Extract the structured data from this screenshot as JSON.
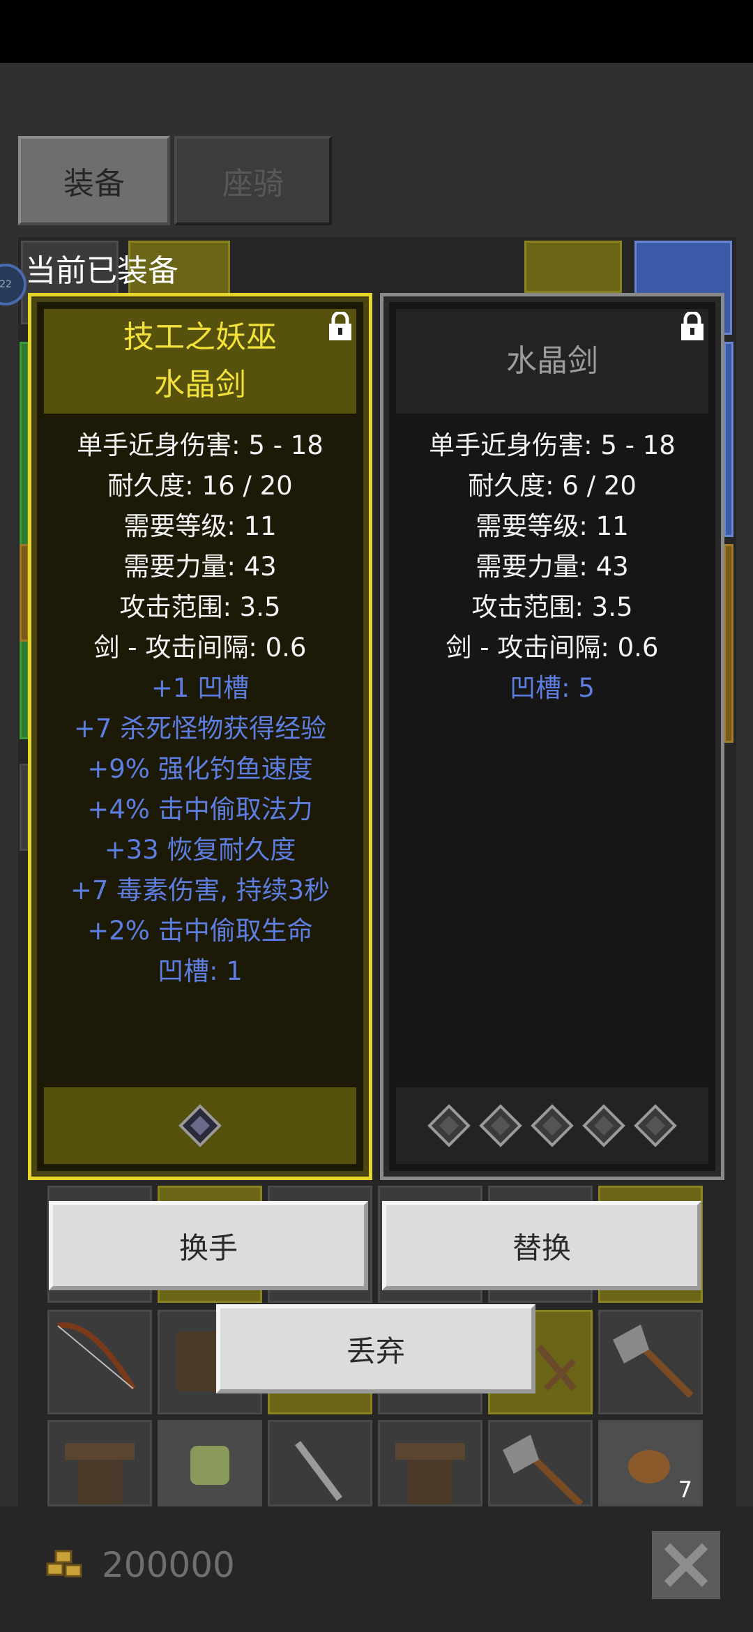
{
  "tabs": [
    {
      "label": "装备"
    },
    {
      "label": "座骑"
    }
  ],
  "level_badge": "22",
  "current_equipped_label": "当前已装备",
  "left_card": {
    "title_line1": "技工之妖巫",
    "title_line2": "水晶剑",
    "border_color": "#e6d52a",
    "stats": [
      {
        "text": "单手近身伤害: 5 - 18",
        "color": "white"
      },
      {
        "text": "耐久度: 16 / 20",
        "color": "white"
      },
      {
        "text": "需要等级: 11",
        "color": "white"
      },
      {
        "text": "需要力量: 43",
        "color": "white"
      },
      {
        "text": "攻击范围: 3.5",
        "color": "white"
      },
      {
        "text": "剑 - 攻击间隔: 0.6",
        "color": "white"
      },
      {
        "text": "+1 凹槽",
        "color": "blue"
      },
      {
        "text": "+7 杀死怪物获得经验",
        "color": "blue"
      },
      {
        "text": "+9% 强化钓鱼速度",
        "color": "blue"
      },
      {
        "text": "+4% 击中偷取法力",
        "color": "blue"
      },
      {
        "text": "+33 恢复耐久度",
        "color": "blue"
      },
      {
        "text": "+7 毒素伤害, 持续3秒",
        "color": "blue"
      },
      {
        "text": "+2% 击中偷取生命",
        "color": "blue"
      },
      {
        "text": "凹槽: 1",
        "color": "blue"
      }
    ],
    "socket_count": 1,
    "socket_filled": true
  },
  "right_card": {
    "title": "水晶剑",
    "border_color": "#8a8a8a",
    "stats": [
      {
        "text": "单手近身伤害: 5 - 18",
        "color": "white"
      },
      {
        "text": "耐久度: 6 / 20",
        "color": "white"
      },
      {
        "text": "需要等级: 11",
        "color": "white"
      },
      {
        "text": "需要力量: 43",
        "color": "white"
      },
      {
        "text": "攻击范围: 3.5",
        "color": "white"
      },
      {
        "text": "剑 - 攻击间隔: 0.6",
        "color": "white"
      },
      {
        "text": "凹槽: 5",
        "color": "blue"
      }
    ],
    "socket_count": 5,
    "socket_filled": false
  },
  "buttons": {
    "swap_hand": "换手",
    "replace": "替换",
    "discard": "丢弃"
  },
  "inventory": {
    "stack_count": "7"
  },
  "gold": "200000",
  "icons": {
    "lock": "padlock-icon",
    "socket": "diamond-socket-icon",
    "gold": "gold-coins-icon",
    "close": "close-x-icon"
  },
  "colors": {
    "item_rare_yellow": "#f2e13a",
    "stat_magic_blue": "#5d7ee0",
    "item_normal_gray": "#9c9c9c"
  }
}
